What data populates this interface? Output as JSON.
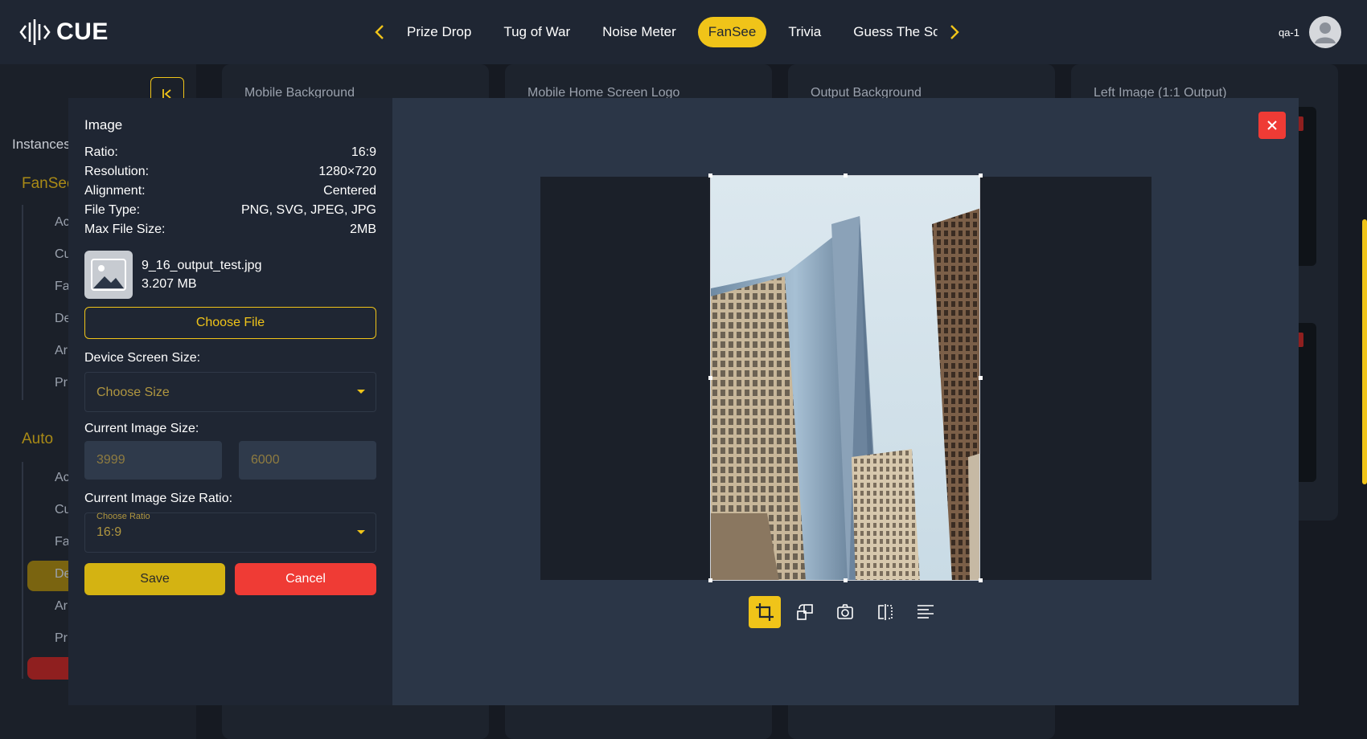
{
  "app": {
    "logo_text": "CUE"
  },
  "nav": {
    "items": [
      "Prize Drop",
      "Tug of War",
      "Noise Meter",
      "FanSee",
      "Trivia",
      "Guess The Score"
    ],
    "active": "FanSee",
    "prev_icon": "chevron-left-icon",
    "next_icon": "chevron-right-icon"
  },
  "user": {
    "name": "qa-1",
    "icon": "user-avatar-icon"
  },
  "background": {
    "sidebar_title": "Instances",
    "groups": [
      {
        "label": "FanSee",
        "items": [
          "Ac",
          "Cu",
          "Fa",
          "De",
          "Ar",
          "Pr"
        ]
      },
      {
        "label": "Auto",
        "items": [
          "Ac",
          "Cu",
          "Fa",
          "De",
          "Ar",
          "Pr"
        ]
      }
    ],
    "card_titles": [
      "Mobile Background",
      "Mobile Home Screen Logo",
      "Output Background",
      "Left Image (1:1 Output)"
    ]
  },
  "modal": {
    "section_title": "Image",
    "specs": [
      {
        "label": "Ratio:",
        "value": "16:9"
      },
      {
        "label": "Resolution:",
        "value": "1280×720"
      },
      {
        "label": "Alignment:",
        "value": "Centered"
      },
      {
        "label": "File Type:",
        "value": "PNG, SVG, JPEG, JPG"
      },
      {
        "label": "Max File Size:",
        "value": "2MB"
      }
    ],
    "file": {
      "name": "9_16_output_test.jpg",
      "size": "3.207 MB",
      "icon": "image-placeholder-icon"
    },
    "choose_file_label": "Choose File",
    "device_size": {
      "label": "Device Screen Size:",
      "value": "Choose Size"
    },
    "image_size": {
      "label": "Current Image Size:",
      "width": "3999",
      "height": "6000"
    },
    "ratio": {
      "label": "Current Image Size Ratio:",
      "float_label": "Choose Ratio",
      "value": "16:9"
    },
    "save_label": "Save",
    "cancel_label": "Cancel",
    "close_icon": "close-icon",
    "tools": [
      "crop-icon",
      "rotate-icon",
      "camera-rotate-icon",
      "flip-horizontal-icon",
      "align-left-icon"
    ],
    "active_tool": "crop-icon"
  },
  "colors": {
    "accent": "#f0c419",
    "danger": "#ef3b35",
    "topbar": "#1f2633",
    "modal": "#2b3647",
    "panel": "#1f2633"
  }
}
